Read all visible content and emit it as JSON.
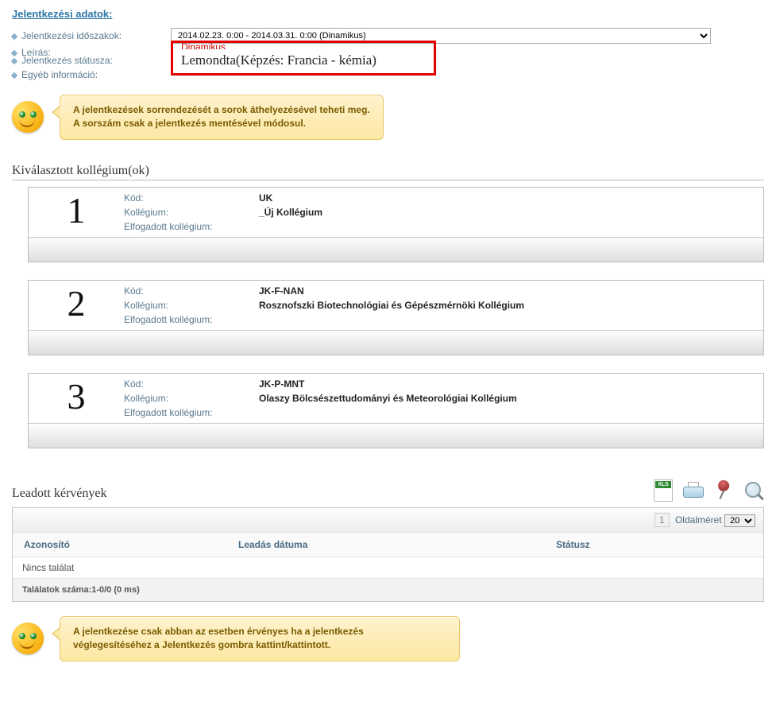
{
  "header": {
    "title": "Jelentkezési adatok:"
  },
  "fields": {
    "period_label": "Jelentkezési időszakok:",
    "description_label": "Leírás:",
    "status_label": "Jelentkezés státusza:",
    "other_label": "Egyéb információ:",
    "period_value": "2014.02.23. 0:00 - 2014.03.31. 0:00 (Dinamikus)",
    "redbox_top": "Dinamikus",
    "redbox_main": "Lemondta(Képzés: Francia - kémia)"
  },
  "tip1": {
    "line1": "A jelentkezések sorrendezését a sorok áthelyezésével teheti meg.",
    "line2": "A sorszám csak a jelentkezés mentésével módosul."
  },
  "colleges": {
    "heading": "Kiválasztott kollégium(ok)",
    "labels": {
      "code": "Kód:",
      "college": "Kollégium:",
      "accepted": "Elfogadott kollégium:"
    },
    "items": [
      {
        "num": "1",
        "code": "UK",
        "name": "_Új Kollégium",
        "accepted": ""
      },
      {
        "num": "2",
        "code": "JK-F-NAN",
        "name": "Rosznofszki Biotechnológiai és Gépészmérnöki Kollégium",
        "accepted": ""
      },
      {
        "num": "3",
        "code": "JK-P-MNT",
        "name": "Olaszy Bölcsészettudományi és Meteorológiai Kollégium",
        "accepted": ""
      }
    ]
  },
  "requests": {
    "title": "Leadott kérvények",
    "page_num": "1",
    "pagesize_label": "Oldalméret",
    "pagesize_value": "20",
    "columns": {
      "id": "Azonosító",
      "date": "Leadás dátuma",
      "status": "Státusz"
    },
    "empty": "Nincs találat",
    "footer": "Találatok száma:1-0/0 (0 ms)"
  },
  "tip2": {
    "line1": "A jelentkezése csak abban az esetben érvényes ha a jelentkezés",
    "line2": "véglegesítéséhez a Jelentkezés gombra kattint/kattintott."
  }
}
